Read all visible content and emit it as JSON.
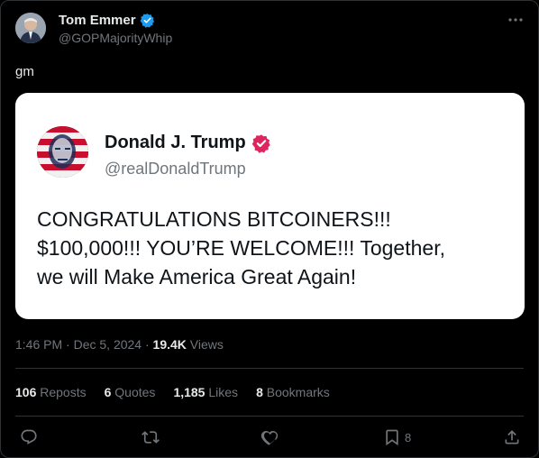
{
  "author": {
    "name": "Tom Emmer",
    "handle": "@GOPMajorityWhip"
  },
  "tweet": {
    "text": "gm"
  },
  "quoted_card": {
    "name": "Donald J. Trump",
    "handle": "@realDonaldTrump",
    "line1": "CONGRATULATIONS BITCOINERS!!!",
    "line2": "$100,000!!! YOU’RE WELCOME!!! Together,",
    "line3": "we will Make America Great Again!"
  },
  "meta": {
    "time": "1:46 PM",
    "sep1": " · ",
    "date": "Dec 5, 2024",
    "sep2": " · ",
    "views_count": "19.4K",
    "views_label": " Views"
  },
  "stats": {
    "reposts_count": "106",
    "reposts_label": "Reposts",
    "quotes_count": "6",
    "quotes_label": "Quotes",
    "likes_count": "1,185",
    "likes_label": "Likes",
    "bookmarks_count": "8",
    "bookmarks_label": "Bookmarks"
  },
  "actions": {
    "bookmark_count": "8"
  },
  "colors": {
    "background": "#000000",
    "text_primary": "#e7e9ea",
    "text_secondary": "#71767b",
    "verified_blue": "#1d9bf0",
    "verified_red": "#e0245e"
  },
  "icons": [
    "verified-badge-icon",
    "more-options-icon",
    "reply-icon",
    "repost-icon",
    "like-icon",
    "bookmark-icon",
    "share-icon"
  ]
}
